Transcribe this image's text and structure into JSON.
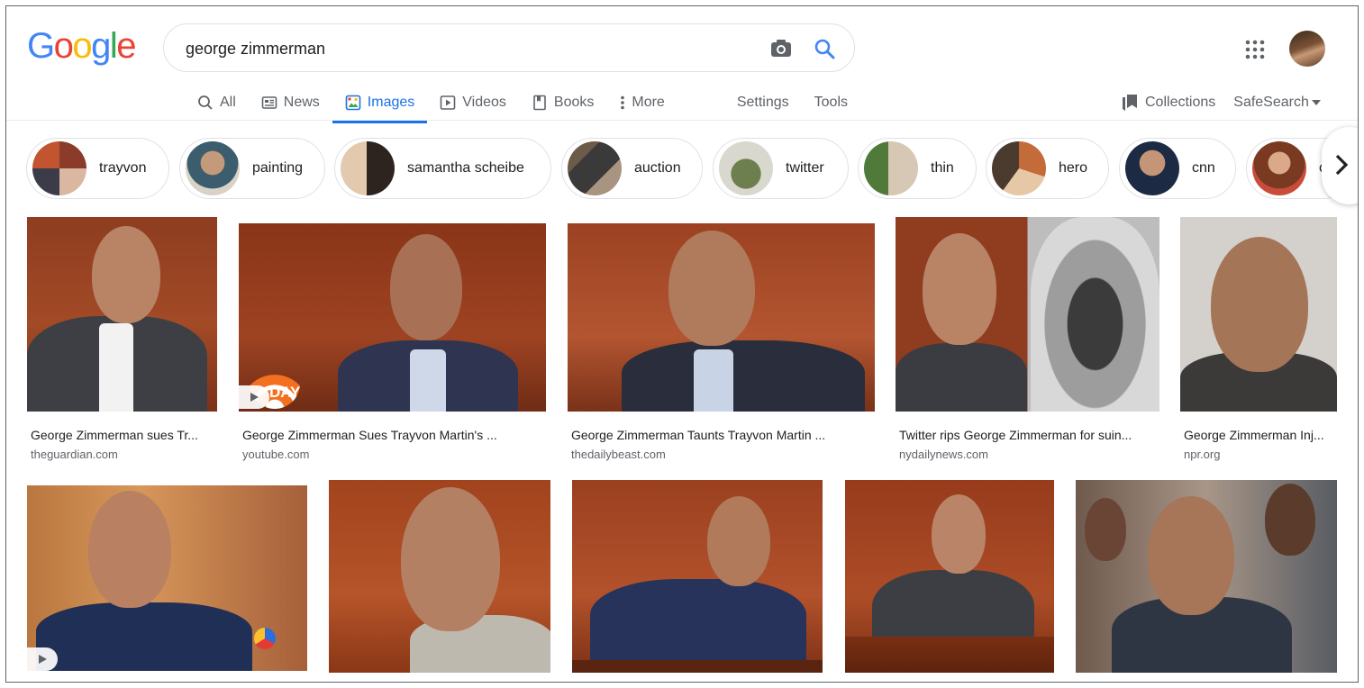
{
  "logo": {
    "letters": [
      "G",
      "o",
      "o",
      "g",
      "l",
      "e"
    ],
    "colors": [
      "#4285f4",
      "#ea4335",
      "#fbbc05",
      "#4285f4",
      "#34a853",
      "#ea4335"
    ]
  },
  "search": {
    "query": "george zimmerman"
  },
  "tabs": [
    {
      "label": "All",
      "icon": "search-icon",
      "active": false
    },
    {
      "label": "News",
      "icon": "news-icon",
      "active": false
    },
    {
      "label": "Images",
      "icon": "images-icon",
      "active": true
    },
    {
      "label": "Videos",
      "icon": "videos-icon",
      "active": false
    },
    {
      "label": "Books",
      "icon": "books-icon",
      "active": false
    },
    {
      "label": "More",
      "icon": "more-vert-icon",
      "active": false
    }
  ],
  "tools": {
    "settings": "Settings",
    "tools": "Tools"
  },
  "right": {
    "collections": "Collections",
    "safesearch": "SafeSearch"
  },
  "chips": [
    {
      "label": "trayvon"
    },
    {
      "label": "painting"
    },
    {
      "label": "samantha scheibe"
    },
    {
      "label": "auction"
    },
    {
      "label": "twitter"
    },
    {
      "label": "thin"
    },
    {
      "label": "hero"
    },
    {
      "label": "cnn"
    },
    {
      "label": "c"
    }
  ],
  "results_row1": [
    {
      "title": "George Zimmerman sues Tr...",
      "source": "theguardian.com",
      "video": false
    },
    {
      "title": "George Zimmerman Sues Trayvon Martin's ...",
      "source": "youtube.com",
      "video": true,
      "overlay_text": "DAY"
    },
    {
      "title": "George Zimmerman Taunts Trayvon Martin ...",
      "source": "thedailybeast.com",
      "video": false
    },
    {
      "title": "Twitter rips George Zimmerman for suin...",
      "source": "nydailynews.com",
      "video": false
    },
    {
      "title": "George Zimmerman Inj...",
      "source": "npr.org",
      "video": false
    }
  ],
  "results_row2": [
    {
      "video": true
    },
    {
      "video": false
    },
    {
      "video": false
    },
    {
      "video": false
    },
    {
      "video": false
    }
  ],
  "colors": {
    "accent": "#1a73e8",
    "wood": "#9b3a1f"
  }
}
